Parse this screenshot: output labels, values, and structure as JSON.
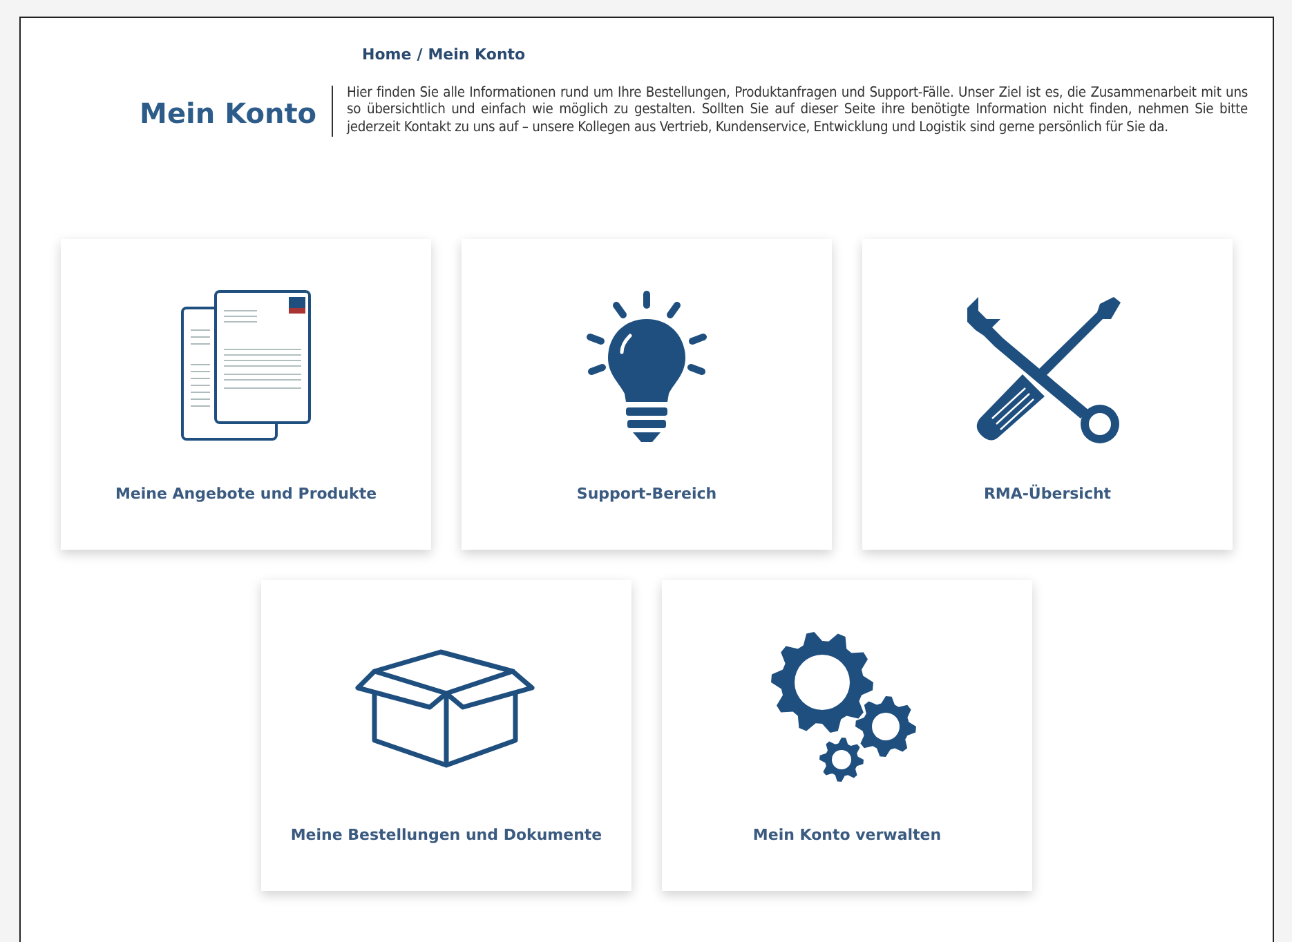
{
  "breadcrumb": [
    "Home",
    "Mein Konto"
  ],
  "breadcrumb_separator": "/",
  "heading": "Mein Konto",
  "intro": "Hier finden Sie alle Informationen rund um Ihre Bestellungen, Produktanfragen und Support-Fälle. Unser Ziel ist es, die Zusammenarbeit mit uns so übersichtlich und einfach wie möglich zu gestalten. Sollten Sie auf dieser Seite ihre benötigte Information nicht finden, nehmen Sie bitte jederzeit Kontakt zu uns auf – unsere Kollegen aus Vertrieb, Kundenservice, Entwicklung und Logistik sind gerne persönlich für Sie da.",
  "tiles": [
    {
      "label": "Meine Angebote und Produkte",
      "kind": "documents"
    },
    {
      "label": "Support-Bereich",
      "kind": "bulb"
    },
    {
      "label": "RMA-Übersicht",
      "kind": "tools"
    },
    {
      "label": "Meine Bestellungen und Dokumente",
      "kind": "box"
    },
    {
      "label": "Mein Konto verwalten",
      "kind": "gears"
    }
  ]
}
